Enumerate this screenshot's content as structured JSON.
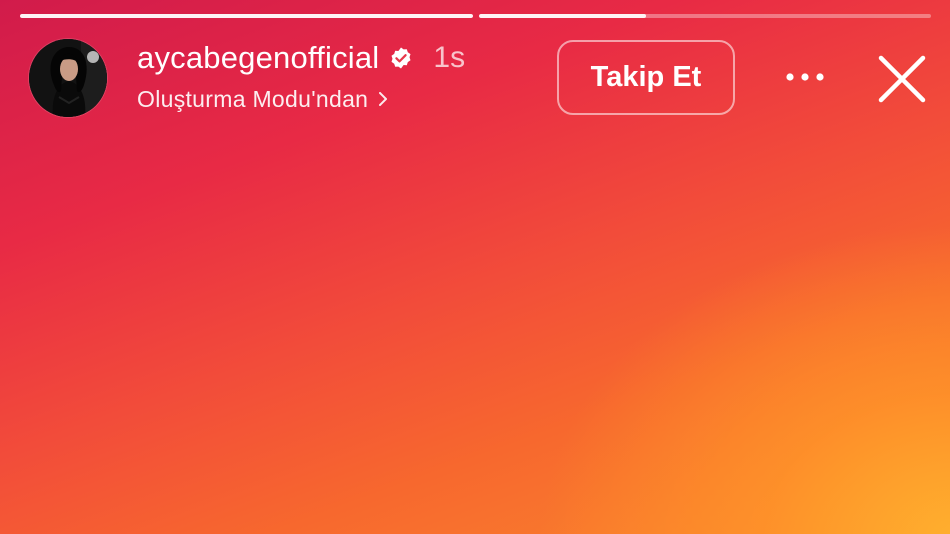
{
  "story": {
    "progress": [
      1.0,
      0.37
    ],
    "user": {
      "username": "aycabegenofficial",
      "verified": true,
      "time_ago": "1s"
    },
    "subtitle": "Oluşturma Modu'ndan",
    "follow_label": "Takip Et"
  },
  "icons": {
    "verified": "verified-badge-icon",
    "subtitle_chevron": "chevron-right-icon",
    "more": "more-horizontal-icon",
    "close": "close-icon"
  },
  "colors": {
    "gradient_top": "#d11b4b",
    "gradient_mid": "#f24c3a",
    "gradient_bottom_right": "#ffb02e"
  }
}
